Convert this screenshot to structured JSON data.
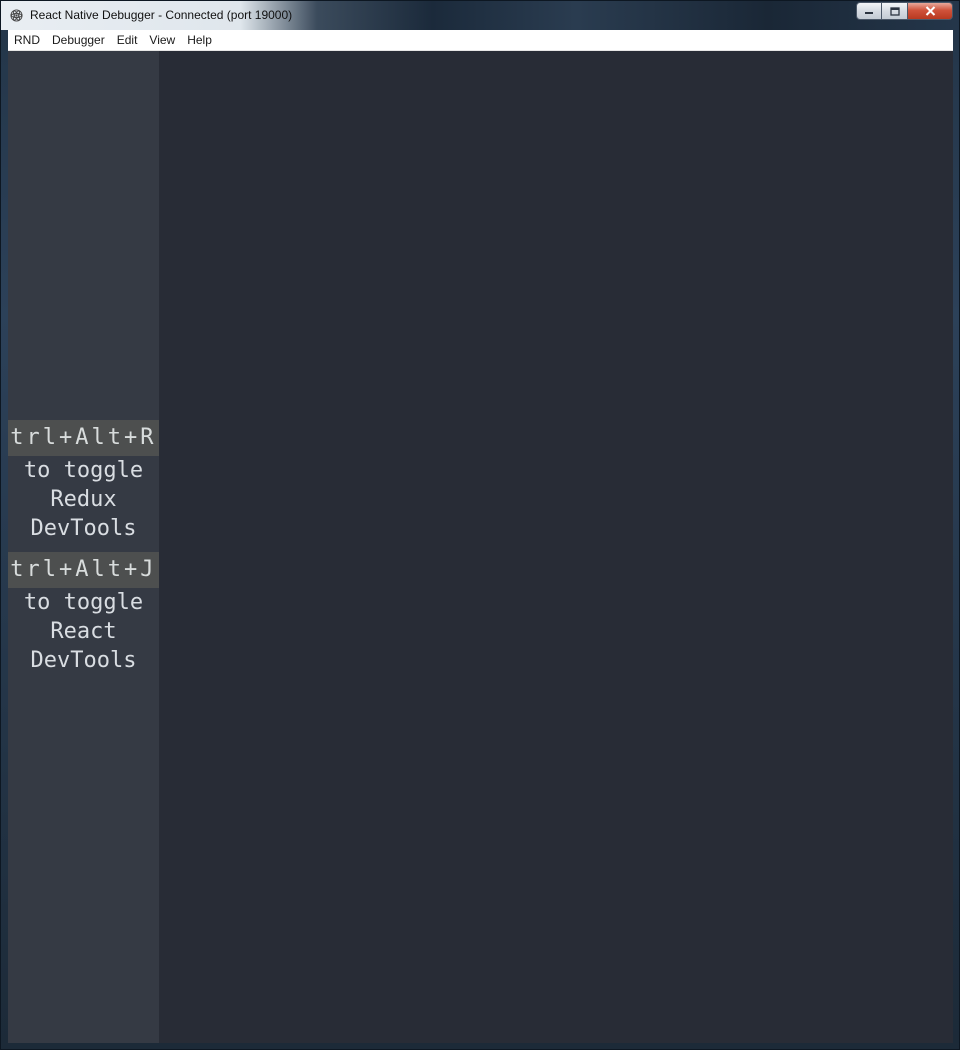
{
  "window": {
    "title": "React Native Debugger - Connected (port 19000)",
    "icon": "react-atom-icon",
    "controls": {
      "minimize": "minimize-icon",
      "maximize": "maximize-icon",
      "close": "close-icon"
    }
  },
  "menubar": {
    "items": [
      "RND",
      "Debugger",
      "Edit",
      "View",
      "Help"
    ]
  },
  "sidebar": {
    "hints": [
      {
        "shortcut": "Ctrl+Alt+R",
        "line1": "to toggle",
        "line2": "Redux",
        "line3": "DevTools"
      },
      {
        "shortcut": "Ctrl+Alt+J",
        "line1": "to toggle",
        "line2": "React",
        "line3": "DevTools"
      }
    ]
  },
  "colors": {
    "sidebar_bg": "#353a44",
    "main_bg": "#282c36",
    "key_highlight_bg": "#4d4f4f",
    "hint_text": "#d9dde2"
  }
}
